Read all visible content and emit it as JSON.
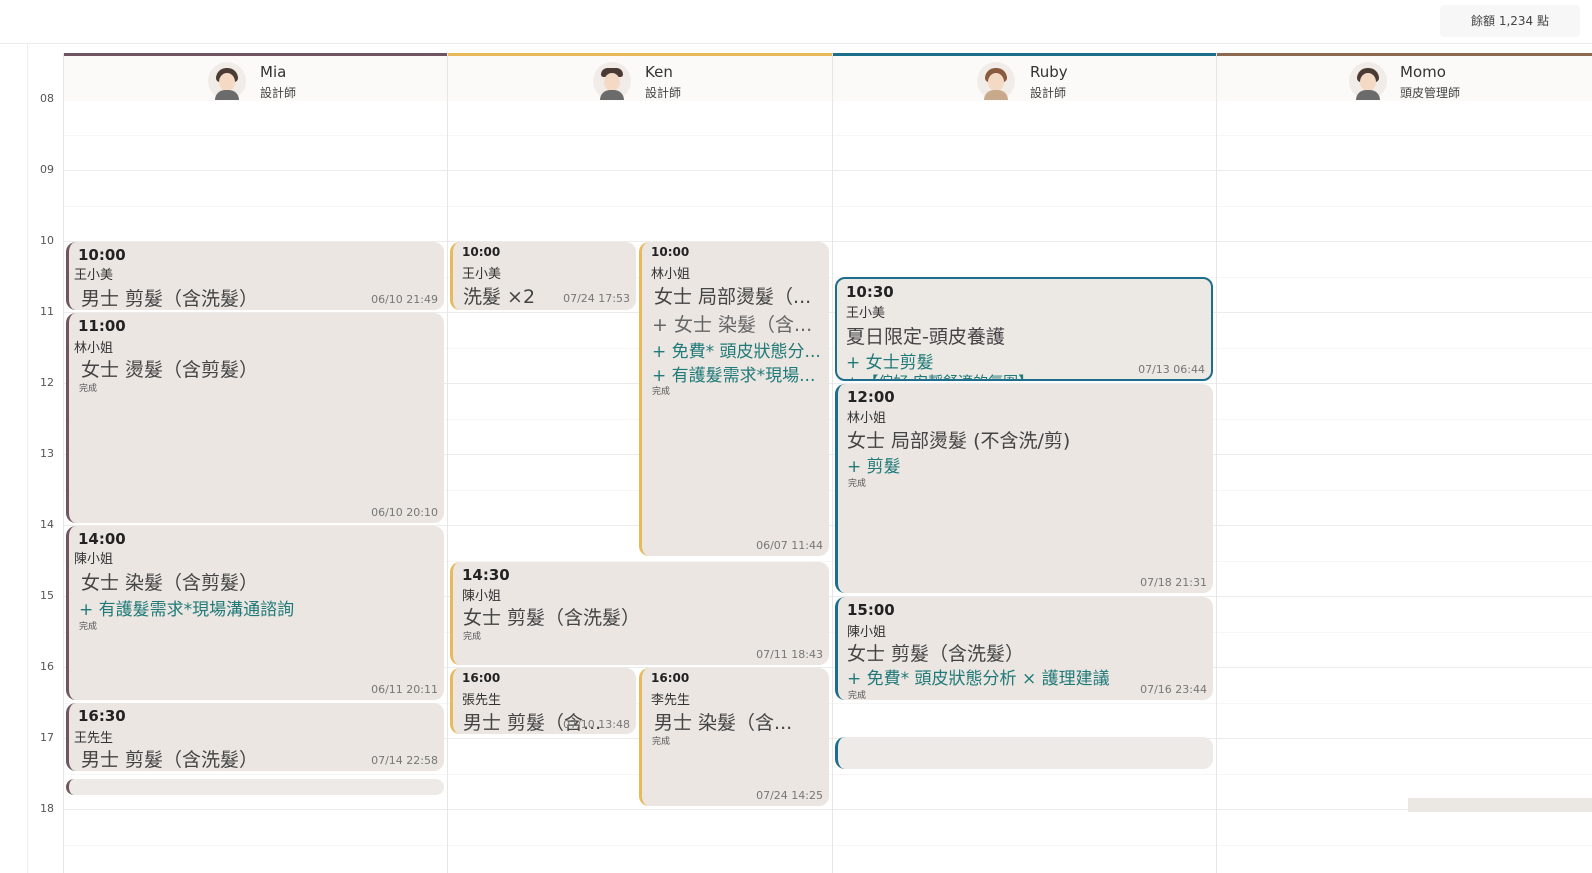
{
  "topbar": {
    "balance": "餘額 1,234 點"
  },
  "hours": [
    "08",
    "09",
    "10",
    "11",
    "12",
    "13",
    "14",
    "15",
    "16",
    "17",
    "18"
  ],
  "staff": [
    {
      "name": "Mia",
      "role": "設計師",
      "color": "#6f5560"
    },
    {
      "name": "Ken",
      "role": "設計師",
      "color": "#e8b95a"
    },
    {
      "name": "Ruby",
      "role": "設計師",
      "color": "#1c6f8a"
    },
    {
      "name": "Momo",
      "role": "頭皮管理師",
      "color": "#8c6a52"
    }
  ],
  "appointments": {
    "mia": [
      {
        "time": "10:00",
        "client": "王小美",
        "service": "男士 剪髮（含洗髮）",
        "stamp": "06/10 21:49"
      },
      {
        "time": "11:00",
        "client": "林小姐",
        "service": "女士 燙髮（含剪髮）",
        "status": "完成",
        "stamp": "06/10 20:10"
      },
      {
        "time": "14:00",
        "client": "陳小姐",
        "service": "女士 染髮（含剪髮）",
        "addon": "+ 有護髮需求*現場溝通諮詢",
        "status": "完成",
        "stamp": "06/11 20:11"
      },
      {
        "time": "16:30",
        "client": "王先生",
        "service": "男士 剪髮（含洗髮）",
        "stamp": "07/14 22:58"
      }
    ],
    "ken": [
      {
        "time": "10:00",
        "client": "王小美",
        "service": "洗髮 ×2",
        "stamp": "07/24 17:53"
      },
      {
        "time": "10:00",
        "client": "林小姐",
        "service": "女士 局部燙髮（...",
        "addon1": "+ 女士 染髮（含...",
        "addon2": "+ 免費* 頭皮狀態分...",
        "addon3": "+ 有護髮需求*現場...",
        "status": "完成",
        "stamp": "06/07 11:44"
      },
      {
        "time": "14:30",
        "client": "陳小姐",
        "service": "女士 剪髮（含洗髮）",
        "status": "完成",
        "stamp": "07/11 18:43"
      },
      {
        "time": "16:00",
        "client": "張先生",
        "service": "男士 剪髮（含...",
        "stamp": "07/10 13:48"
      },
      {
        "time": "16:00",
        "client": "李先生",
        "service": "男士 染髮（含...",
        "status": "完成",
        "stamp": "07/24 14:25"
      }
    ],
    "ruby": [
      {
        "time": "10:30",
        "client": "王小美",
        "service": "夏日限定-頭皮養護",
        "addon": "+ 女士剪髮",
        "addon2": "+ 【偏好 安靜舒適的氛圍】",
        "stamp": "07/13 06:44"
      },
      {
        "time": "12:00",
        "client": "林小姐",
        "service": "女士 局部燙髮 (不含洗/剪)",
        "addon": "+ 剪髮",
        "status": "完成",
        "stamp": "07/18 21:31"
      },
      {
        "time": "15:00",
        "client": "陳小姐",
        "service": "女士 剪髮（含洗髮）",
        "addon": "+ 免費* 頭皮狀態分析 × 護理建議",
        "status": "完成",
        "stamp": "07/16 23:44"
      }
    ]
  }
}
